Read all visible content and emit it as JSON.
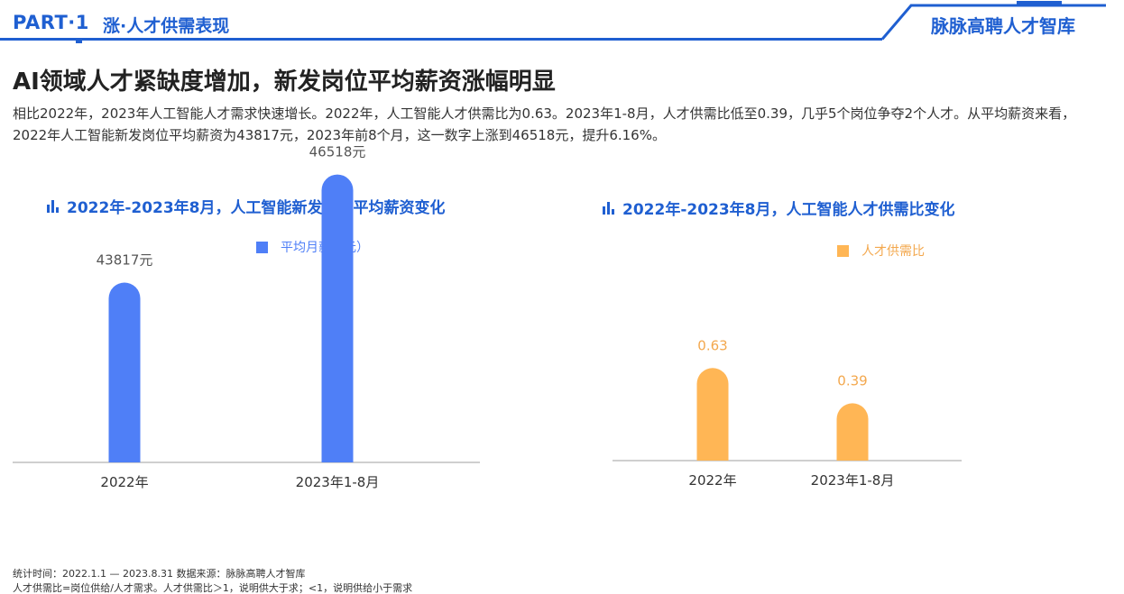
{
  "header": {
    "part": "PART·1",
    "section": "涨·人才供需表现",
    "brand": "脉脉高聘人才智库",
    "accent_color": "#1f5fd1"
  },
  "title": "AI领域人才紧缺度增加，新发岗位平均薪资涨幅明显",
  "description": "相比2022年，2023年人工智能人才需求快速增长。2022年，人工智能人才供需比为0.63。2023年1-8月，人才供需比低至0.39，几乎5个岗位争夺2个人才。从平均薪资来看，2022年人工智能新发岗位平均薪资为43817元，2023年前8个月，这一数字上涨到46518元，提升6.16%。",
  "chart_data": [
    {
      "type": "bar",
      "title": "2022年-2023年8月，人工智能新发岗位平均薪资变化",
      "categories": [
        "2022年",
        "2023年1-8月"
      ],
      "series": [
        {
          "name": "平均月薪（元）",
          "values": [
            43817,
            46518
          ],
          "color": "#4f7ff7"
        }
      ],
      "data_labels": [
        "43817元",
        "46518元"
      ],
      "icon": "bar-chart-icon"
    },
    {
      "type": "bar",
      "title": "2022年-2023年8月，人工智能人才供需比变化",
      "categories": [
        "2022年",
        "2023年1-8月"
      ],
      "series": [
        {
          "name": "人才供需比",
          "values": [
            0.63,
            0.39
          ],
          "color": "#ffb655"
        }
      ],
      "data_labels": [
        "0.63",
        "0.39"
      ],
      "icon": "bar-chart-icon"
    }
  ],
  "footnotes": {
    "line1": "统计时间：2022.1.1 — 2023.8.31  数据来源：脉脉高聘人才智库",
    "line2": "人才供需比=岗位供给/人才需求。人才供需比＞1，说明供大于求；<1，说明供给小于需求"
  }
}
